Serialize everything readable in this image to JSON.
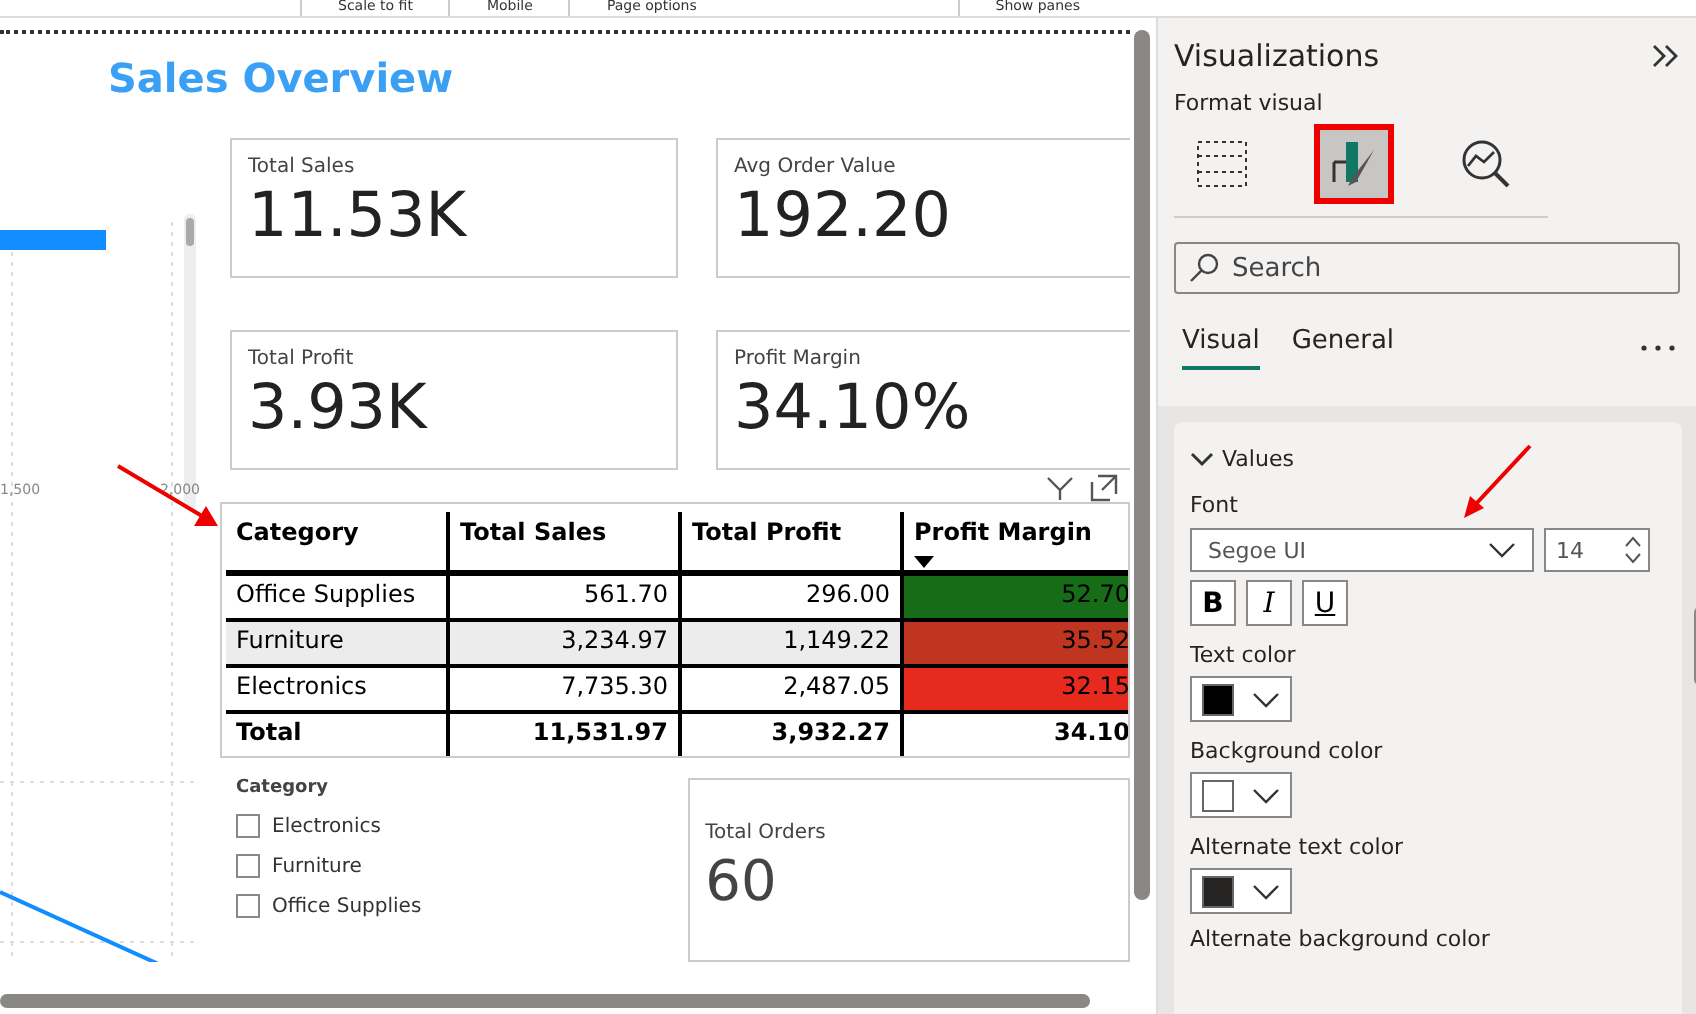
{
  "ribbon": {
    "items": [
      "Scale to fit",
      "Mobile",
      "Page options",
      "Show panes"
    ]
  },
  "report": {
    "title": "Sales Overview",
    "left_chart": {
      "axis_labels": [
        "1,500",
        "2,000"
      ]
    },
    "cards": [
      {
        "label": "Total Sales",
        "value": "11.53K"
      },
      {
        "label": "Avg Order Value",
        "value": "192.20"
      },
      {
        "label": "Total Profit",
        "value": "3.93K"
      },
      {
        "label": "Profit Margin",
        "value": "34.10%"
      }
    ],
    "table": {
      "columns": [
        {
          "label": "Category",
          "sorted": false
        },
        {
          "label": "Total Sales",
          "sorted": false
        },
        {
          "label": "Total Profit",
          "sorted": false
        },
        {
          "label": "Profit Margin",
          "sorted": true
        }
      ],
      "rows": [
        {
          "cells": [
            "Office Supplies",
            "561.70",
            "296.00",
            "52.70"
          ],
          "highlighted": false,
          "color": "#176d17"
        },
        {
          "cells": [
            "Furniture",
            "3,234.97",
            "1,149.22",
            "35.52"
          ],
          "highlighted": true,
          "color": "#c0351f"
        },
        {
          "cells": [
            "Electronics",
            "7,735.30",
            "2,487.05",
            "32.15"
          ],
          "highlighted": false,
          "color": "#e62a1e"
        }
      ],
      "total": [
        "Total",
        "11,531.97",
        "3,932.27",
        "34.10"
      ]
    },
    "slicer": {
      "title": "Category",
      "items": [
        {
          "label": "Electronics",
          "checked": false
        },
        {
          "label": "Furniture",
          "checked": false
        },
        {
          "label": "Office Supplies",
          "checked": false
        }
      ]
    },
    "orders_card": {
      "label": "Total Orders",
      "value": "60"
    }
  },
  "pane": {
    "title": "Visualizations",
    "subtitle": "Format visual",
    "icon_tabs": [
      {
        "kind": "build",
        "selected": false
      },
      {
        "kind": "format",
        "selected": true
      },
      {
        "kind": "analytics",
        "selected": false
      }
    ],
    "search": {
      "placeholder": "Search"
    },
    "tabs": [
      {
        "label": "Visual",
        "selected": true
      },
      {
        "label": "General",
        "selected": false
      }
    ],
    "section": {
      "title": "Values",
      "expanded": true,
      "font_label": "Font",
      "font": "Segoe UI",
      "size": "14",
      "style_buttons": [
        {
          "kind": "bold",
          "label": "B"
        },
        {
          "kind": "italic",
          "label": "I"
        },
        {
          "kind": "underline",
          "label": "U"
        }
      ],
      "colors": [
        {
          "label": "Text color",
          "color": "#000000"
        },
        {
          "label": "Background color",
          "color": "#ffffff"
        },
        {
          "label": "Alternate text color",
          "color": "#252423"
        }
      ],
      "cut_label": "Alternate background color"
    }
  }
}
